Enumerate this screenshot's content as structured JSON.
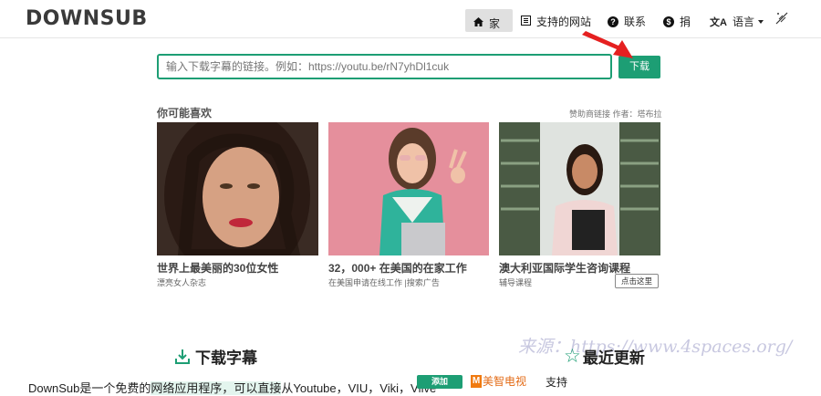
{
  "header": {
    "logo": "DOWNSUB",
    "nav": {
      "home": "家",
      "sites": "支持的网站",
      "contact": "联系",
      "donate": "捐",
      "language": "语言"
    }
  },
  "search": {
    "placeholder": "输入下载字幕的链接。例如：https://youtu.be/rN7yhDl1cuk",
    "button": "下载"
  },
  "recommend": {
    "title": "你可能喜欢",
    "sponsor": "赞助商链接 作者：塔布拉",
    "cards": [
      {
        "title": "世界上最美丽的30位女性",
        "sub": "漂亮女人杂志"
      },
      {
        "title": "32，000+ 在美国的在家工作",
        "sub": "在美国申请在线工作 |搜索广告"
      },
      {
        "title": "澳大利亚国际学生咨询课程",
        "sub": "辅导课程",
        "button": "点击这里"
      }
    ]
  },
  "watermark": "来源：https://www.4spaces.org/",
  "download_heading": "下载字幕",
  "recent_heading": "最近更新",
  "footer": {
    "text_a": "DownSub是一个免费的",
    "text_b": "网络应用程序，可以直接",
    "text_c": "从Youtube，VIU，Viki，Vlive",
    "add_button": "添加",
    "brand": "美智电视",
    "support": "支持"
  },
  "colors": {
    "accent": "#1d9e74",
    "arrow": "#e52020"
  },
  "icons": [
    "home-icon",
    "list-icon",
    "question-icon",
    "dollar-icon",
    "translate-icon",
    "theme-toggle-icon",
    "download-icon",
    "star-icon"
  ]
}
